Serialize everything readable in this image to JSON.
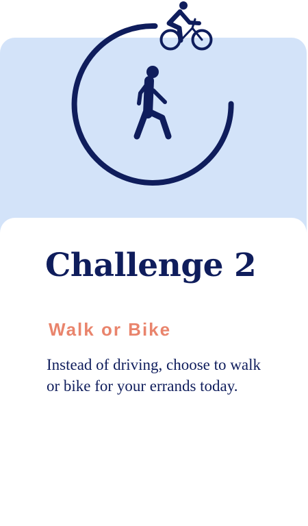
{
  "challenge": {
    "title": "Challenge 2",
    "subtitle": "Walk or Bike",
    "description": "Instead of driving, choose to walk or bike for your errands today."
  },
  "icons": {
    "cyclist": "cyclist-icon",
    "walker": "pedestrian-icon",
    "ring": "progress-ring"
  },
  "colors": {
    "navy": "#0f1d5c",
    "light_blue": "#d3e3f9",
    "accent_coral": "#e9846c",
    "background": "#ffffff"
  }
}
